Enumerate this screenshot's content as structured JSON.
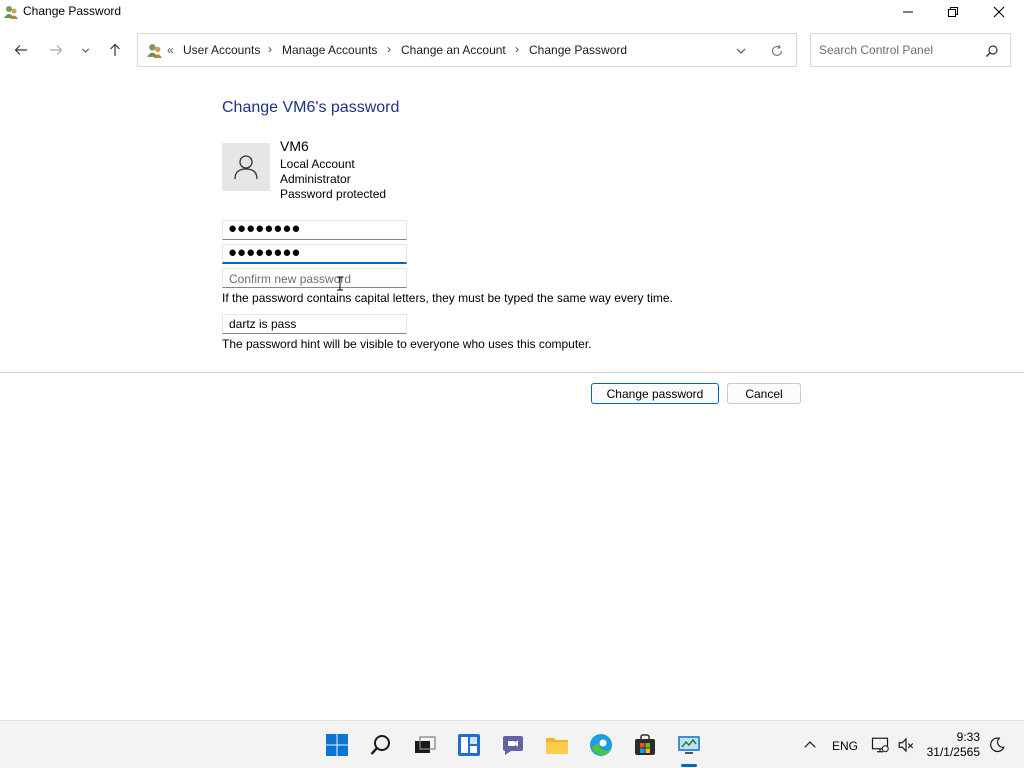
{
  "window": {
    "title": "Change Password"
  },
  "address": {
    "overflow": "«",
    "crumbs": [
      "User Accounts",
      "Manage Accounts",
      "Change an Account",
      "Change Password"
    ],
    "sep": "›"
  },
  "search": {
    "placeholder": "Search Control Panel"
  },
  "content": {
    "title": "Change VM6's password",
    "account_name": "VM6",
    "account_type": "Local Account",
    "account_role": "Administrator",
    "account_status": "Password protected",
    "current_password_mask": "●●●●●●●●",
    "new_password_mask": "●●●●●●●●",
    "confirm_placeholder": "Confirm new password",
    "case_note": "If the password contains capital letters, they must be typed the same way every time.",
    "hint_value": "dartz is pass",
    "hint_note": "The password hint will be visible to everyone who uses this computer."
  },
  "buttons": {
    "change": "Change password",
    "cancel": "Cancel"
  },
  "taskbar": {
    "lang": "ENG",
    "time": "9:33",
    "date": "31/1/2565"
  },
  "colors": {
    "accent": "#0067c0",
    "title": "#1e3287"
  }
}
